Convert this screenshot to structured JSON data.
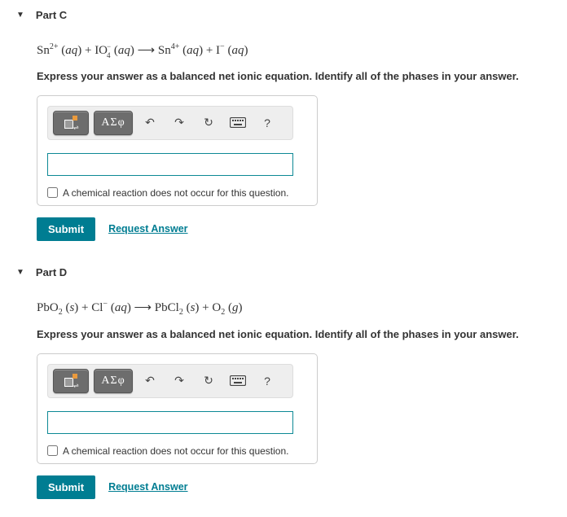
{
  "parts": [
    {
      "id": "C",
      "title": "Part C",
      "equation_html": "Sn<sup>2+</sup> (<span class='aq'>aq</span>) + IO<span class='sub-sup-stack'><span>−</span><span>4</span></span> (<span class='aq'>aq</span>) ⟶ Sn<sup>4+</sup> (<span class='aq'>aq</span>) + I<sup>−</sup> (<span class='aq'>aq</span>)",
      "instructions": "Express your answer as a balanced net ionic equation. Identify all of the phases in your answer.",
      "no_reaction_label": "A chemical reaction does not occur for this question.",
      "submit_label": "Submit",
      "request_label": "Request Answer",
      "greek_label": "ΑΣφ",
      "help_label": "?"
    },
    {
      "id": "D",
      "title": "Part D",
      "equation_html": "PbO<sub>2</sub> (<span class='aq'>s</span>) + Cl<sup>−</sup> (<span class='aq'>aq</span>) ⟶ PbCl<sub>2</sub> (<span class='aq'>s</span>) + O<sub>2</sub> (<span class='aq'>g</span>)",
      "instructions": "Express your answer as a balanced net ionic equation. Identify all of the phases in your answer.",
      "no_reaction_label": "A chemical reaction does not occur for this question.",
      "submit_label": "Submit",
      "request_label": "Request Answer",
      "greek_label": "ΑΣφ",
      "help_label": "?"
    }
  ]
}
